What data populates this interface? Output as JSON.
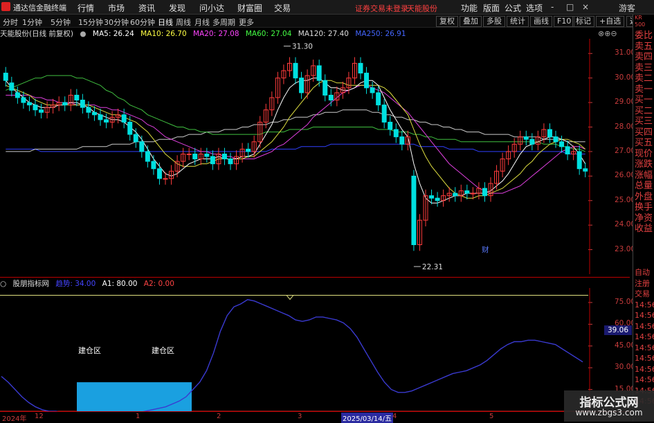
{
  "app": {
    "title": "通达信金融终端",
    "menu": [
      "行情",
      "市场",
      "资讯",
      "发现",
      "问小达",
      "财富圈",
      "交易"
    ],
    "notice_left": "证券交易未登录",
    "notice_right": "天能股份",
    "right_menu": [
      "功能",
      "版面",
      "公式",
      "选项"
    ],
    "window_controls": [
      "-",
      "□",
      "×"
    ],
    "guest": "游客"
  },
  "toolbar": {
    "periods": [
      "分时",
      "1分钟",
      "5分钟",
      "15分钟",
      "30分钟",
      "60分钟",
      "日线",
      "周线",
      "月线",
      "多周期",
      "更多"
    ],
    "active_period": "日线",
    "buttons": [
      "复权",
      "叠加",
      "多股",
      "统计",
      "画线",
      "F10",
      "标记",
      "+自选",
      "返回"
    ]
  },
  "main_chart": {
    "title": "天能股份(日线 前复权)",
    "ma": [
      {
        "label": "MA5: 26.24",
        "color": "#ffffff"
      },
      {
        "label": "MA10: 26.70",
        "color": "#ffff40"
      },
      {
        "label": "MA20: 27.08",
        "color": "#ff40ff"
      },
      {
        "label": "MA60: 27.04",
        "color": "#40ff40"
      },
      {
        "label": "MA120: 27.40",
        "color": "#dddddd"
      },
      {
        "label": "MA250: 26.91",
        "color": "#4060ff"
      }
    ],
    "y_ticks": [
      "31.00",
      "30.00",
      "29.00",
      "28.00",
      "27.00",
      "26.00",
      "25.00",
      "24.00",
      "23.00"
    ],
    "high_label": "31.30",
    "low_label": "22.31",
    "cai_label": "财"
  },
  "indicator": {
    "name": "股朋指标网",
    "values": [
      {
        "label": "趋势: 34.00",
        "color": "#4040ff"
      },
      {
        "label": "A1: 80.00",
        "color": "#ffffff"
      },
      {
        "label": "A2: 0.00",
        "color": "#ff4040"
      }
    ],
    "y_ticks": [
      "75.00",
      "60.00",
      "45.00",
      "30.00",
      "15.00"
    ],
    "current_value": "39.06",
    "zone_label": "建仓区"
  },
  "x_axis": [
    "2024年",
    "12",
    "1",
    "2",
    "3",
    "2025/03/14/五",
    "4",
    "5"
  ],
  "right_column_top": [
    "委比",
    "卖五",
    "卖四",
    "卖三",
    "卖二",
    "卖一",
    "买一",
    "买二",
    "买三",
    "买四",
    "买五",
    "现价",
    "涨跌",
    "涨幅",
    "总量",
    "外盘",
    "换手",
    "净资",
    "收益"
  ],
  "right_column_bottom": [
    "自动",
    "注册",
    "交易",
    "14:56",
    "14:56",
    "14:56",
    "14:56",
    "14:56",
    "14:56",
    "14:56",
    "14:56",
    "14:56",
    "14:56"
  ],
  "corner_label": "KR 500",
  "watermark": {
    "line1": "指标公式网",
    "line2": "www.zbgs3.com"
  },
  "chart_data": {
    "type": "candlestick",
    "price_range": [
      22.0,
      31.6
    ],
    "closes": [
      29.9,
      29.5,
      29.2,
      29.0,
      28.9,
      28.7,
      28.6,
      28.8,
      28.9,
      29.0,
      28.9,
      29.3,
      29.1,
      28.8,
      28.6,
      28.5,
      28.3,
      28.2,
      28.4,
      28.5,
      28.2,
      27.7,
      27.4,
      27.0,
      26.6,
      26.3,
      25.9,
      25.9,
      26.2,
      26.6,
      26.9,
      26.9,
      26.7,
      26.9,
      26.8,
      26.5,
      26.9,
      26.7,
      26.5,
      26.8,
      27.1,
      27.0,
      27.4,
      28.2,
      28.7,
      29.2,
      30.0,
      30.3,
      30.6,
      30.0,
      29.4,
      30.1,
      30.5,
      29.9,
      29.3,
      29.1,
      29.4,
      29.6,
      30.0,
      30.6,
      30.2,
      29.6,
      29.4,
      28.9,
      28.2,
      27.9,
      27.6,
      27.3,
      27.6,
      23.2,
      24.2,
      25.2,
      25.1,
      25.0,
      25.2,
      25.3,
      25.2,
      25.4,
      25.3,
      25.3,
      25.5,
      25.2,
      25.7,
      26.2,
      26.7,
      27.0,
      27.3,
      27.6,
      27.5,
      27.3,
      27.6,
      27.9,
      27.6,
      27.4,
      27.2,
      26.9,
      27.0,
      26.3,
      26.2
    ],
    "opens": [
      30.2,
      29.8,
      29.4,
      29.2,
      29.0,
      28.9,
      28.7,
      28.6,
      28.8,
      28.9,
      29.0,
      28.9,
      29.3,
      29.1,
      28.8,
      28.6,
      28.5,
      28.3,
      28.2,
      28.4,
      28.5,
      28.2,
      27.7,
      27.4,
      27.0,
      26.6,
      26.3,
      25.9,
      25.9,
      26.2,
      26.6,
      26.9,
      26.9,
      26.7,
      26.9,
      26.8,
      26.5,
      26.9,
      26.7,
      26.5,
      26.8,
      27.1,
      27.0,
      27.4,
      28.2,
      28.7,
      29.2,
      30.0,
      30.3,
      30.6,
      30.0,
      29.4,
      30.1,
      30.5,
      29.9,
      29.3,
      29.1,
      29.4,
      29.6,
      30.0,
      30.6,
      30.2,
      29.6,
      29.4,
      28.9,
      28.2,
      27.9,
      27.6,
      27.3,
      26.0,
      23.2,
      24.2,
      25.2,
      25.1,
      25.0,
      25.2,
      25.3,
      25.2,
      25.4,
      25.3,
      25.3,
      25.5,
      25.2,
      25.7,
      26.2,
      26.7,
      27.0,
      27.3,
      27.6,
      27.5,
      27.3,
      27.6,
      27.9,
      27.6,
      27.4,
      27.2,
      26.9,
      27.0,
      26.3
    ],
    "ma5": [
      29.9,
      29.6,
      29.4,
      29.2,
      29.0,
      28.9,
      28.8,
      28.8,
      28.8,
      28.9,
      28.9,
      29.0,
      29.0,
      28.9,
      28.8,
      28.6,
      28.5,
      28.4,
      28.3,
      28.3,
      28.2,
      28.0,
      27.8,
      27.5,
      27.1,
      26.7,
      26.4,
      26.1,
      26.0,
      26.1,
      26.3,
      26.5,
      26.6,
      26.7,
      26.7,
      26.7,
      26.8,
      26.7,
      26.7,
      26.7,
      26.8,
      26.8,
      26.9,
      27.3,
      27.7,
      28.1,
      28.7,
      29.2,
      29.6,
      29.8,
      29.9,
      29.9,
      30.0,
      30.0,
      29.8,
      29.6,
      29.6,
      29.5,
      29.5,
      29.6,
      29.8,
      29.9,
      29.9,
      29.7,
      29.2,
      28.7,
      28.3,
      27.9,
      27.6,
      26.5,
      25.7,
      25.1,
      24.9,
      24.9,
      25.0,
      25.1,
      25.2,
      25.2,
      25.3,
      25.3,
      25.3,
      25.3,
      25.4,
      25.6,
      25.8,
      26.1,
      26.5,
      26.9,
      27.2,
      27.3,
      27.4,
      27.5,
      27.6,
      27.6,
      27.5,
      27.4,
      27.2,
      26.9,
      26.5
    ],
    "ma10": [
      29.7,
      29.6,
      29.5,
      29.4,
      29.3,
      29.1,
      29.0,
      28.9,
      28.9,
      28.9,
      28.9,
      28.9,
      28.9,
      28.9,
      28.9,
      28.8,
      28.7,
      28.6,
      28.5,
      28.5,
      28.4,
      28.3,
      28.2,
      28.0,
      27.8,
      27.5,
      27.2,
      26.9,
      26.7,
      26.5,
      26.4,
      26.4,
      26.4,
      26.5,
      26.5,
      26.6,
      26.7,
      26.7,
      26.7,
      26.7,
      26.7,
      26.8,
      26.8,
      27.0,
      27.2,
      27.4,
      27.7,
      28.0,
      28.4,
      28.7,
      29.0,
      29.3,
      29.6,
      29.8,
      29.9,
      29.9,
      29.8,
      29.8,
      29.7,
      29.7,
      29.7,
      29.7,
      29.7,
      29.7,
      29.6,
      29.4,
      29.1,
      28.8,
      28.5,
      27.9,
      27.3,
      26.8,
      26.4,
      26.1,
      25.8,
      25.5,
      25.3,
      25.2,
      25.1,
      25.1,
      25.2,
      25.2,
      25.3,
      25.4,
      25.5,
      25.7,
      25.9,
      26.1,
      26.4,
      26.6,
      26.9,
      27.1,
      27.3,
      27.4,
      27.5,
      27.5,
      27.4,
      27.3,
      27.1
    ],
    "ma20": [
      29.3,
      29.3,
      29.3,
      29.3,
      29.3,
      29.2,
      29.2,
      29.1,
      29.1,
      29.0,
      29.0,
      29.0,
      28.9,
      28.9,
      28.9,
      28.9,
      28.8,
      28.8,
      28.7,
      28.7,
      28.6,
      28.5,
      28.4,
      28.3,
      28.1,
      28.0,
      27.8,
      27.6,
      27.5,
      27.4,
      27.3,
      27.2,
      27.1,
      27.0,
      27.0,
      26.9,
      26.9,
      26.8,
      26.8,
      26.7,
      26.7,
      26.7,
      26.7,
      26.8,
      26.9,
      27.0,
      27.2,
      27.3,
      27.5,
      27.7,
      27.9,
      28.1,
      28.4,
      28.6,
      28.8,
      29.0,
      29.2,
      29.4,
      29.5,
      29.6,
      29.7,
      29.7,
      29.6,
      29.5,
      29.4,
      29.2,
      29.0,
      28.8,
      28.6,
      28.3,
      28.0,
      27.7,
      27.4,
      27.1,
      26.8,
      26.5,
      26.3,
      26.1,
      25.9,
      25.7,
      25.5,
      25.4,
      25.3,
      25.3,
      25.3,
      25.4,
      25.5,
      25.6,
      25.8,
      26.0,
      26.2,
      26.4,
      26.6,
      26.8,
      27.0,
      27.1,
      27.2,
      27.2,
      27.1
    ],
    "ma60": [
      29.5,
      29.6,
      29.7,
      29.8,
      29.9,
      30.0,
      30.0,
      30.1,
      30.1,
      30.1,
      30.1,
      30.1,
      30.0,
      30.0,
      29.9,
      29.8,
      29.7,
      29.5,
      29.4,
      29.2,
      29.1,
      28.9,
      28.8,
      28.7,
      28.5,
      28.4,
      28.3,
      28.2,
      28.1,
      28.0,
      28.0,
      27.9,
      27.9,
      27.8,
      27.8,
      27.7,
      27.7,
      27.7,
      27.7,
      27.7,
      27.7,
      27.7,
      27.7,
      27.7,
      27.8,
      27.8,
      27.8,
      27.8,
      27.9,
      27.9,
      27.9,
      27.9,
      28.0,
      28.0,
      28.0,
      28.0,
      28.0,
      28.0,
      28.0,
      28.0,
      28.0,
      28.0,
      28.0,
      27.9,
      27.9,
      27.9,
      27.8,
      27.8,
      27.8,
      27.7,
      27.7,
      27.6,
      27.6,
      27.5,
      27.5,
      27.5,
      27.5,
      27.4,
      27.4,
      27.4,
      27.4,
      27.4,
      27.4,
      27.4,
      27.4,
      27.4,
      27.4,
      27.4,
      27.4,
      27.4,
      27.4,
      27.3,
      27.3,
      27.3,
      27.2,
      27.2,
      27.1,
      27.1,
      27.0
    ],
    "ma120": [
      27.0,
      27.0,
      27.0,
      27.0,
      27.0,
      27.1,
      27.1,
      27.1,
      27.1,
      27.1,
      27.1,
      27.1,
      27.1,
      27.2,
      27.2,
      27.2,
      27.2,
      27.2,
      27.3,
      27.3,
      27.3,
      27.3,
      27.4,
      27.4,
      27.4,
      27.4,
      27.5,
      27.5,
      27.5,
      27.6,
      27.6,
      27.7,
      27.7,
      27.7,
      27.8,
      27.8,
      27.8,
      27.9,
      27.9,
      27.9,
      28.0,
      28.0,
      28.1,
      28.1,
      28.1,
      28.2,
      28.2,
      28.3,
      28.3,
      28.4,
      28.4,
      28.4,
      28.5,
      28.5,
      28.6,
      28.6,
      28.6,
      28.7,
      28.7,
      28.7,
      28.7,
      28.7,
      28.6,
      28.6,
      28.5,
      28.5,
      28.4,
      28.4,
      28.3,
      28.3,
      28.2,
      28.2,
      28.1,
      28.1,
      28.0,
      28.0,
      27.9,
      27.9,
      27.8,
      27.8,
      27.8,
      27.7,
      27.7,
      27.7,
      27.7,
      27.7,
      27.6,
      27.6,
      27.6,
      27.6,
      27.6,
      27.5,
      27.5,
      27.5,
      27.5,
      27.4,
      27.4,
      27.4,
      27.4
    ],
    "ma250": [
      27.1,
      27.1,
      27.1,
      27.1,
      27.1,
      27.1,
      27.0,
      27.0,
      27.0,
      27.0,
      27.0,
      27.0,
      27.0,
      27.0,
      27.0,
      27.0,
      27.0,
      27.0,
      27.0,
      27.0,
      27.0,
      27.0,
      27.0,
      27.0,
      27.0,
      27.0,
      27.0,
      27.0,
      27.0,
      27.0,
      27.0,
      27.0,
      27.0,
      27.0,
      27.0,
      27.0,
      27.0,
      27.0,
      27.0,
      27.0,
      27.0,
      27.0,
      27.0,
      27.0,
      27.0,
      27.1,
      27.1,
      27.1,
      27.1,
      27.1,
      27.2,
      27.2,
      27.2,
      27.2,
      27.2,
      27.3,
      27.3,
      27.3,
      27.3,
      27.3,
      27.3,
      27.3,
      27.3,
      27.3,
      27.3,
      27.3,
      27.3,
      27.3,
      27.3,
      27.3,
      27.2,
      27.2,
      27.2,
      27.2,
      27.2,
      27.1,
      27.1,
      27.1,
      27.1,
      27.1,
      27.0,
      27.0,
      27.0,
      27.0,
      27.0,
      27.0,
      27.0,
      27.0,
      27.0,
      27.0,
      27.0,
      27.0,
      27.0,
      27.0,
      27.0,
      26.9,
      26.9,
      26.9,
      26.9
    ],
    "indicator_range": [
      0,
      85
    ],
    "trend": [
      24,
      20,
      15,
      10,
      6,
      3,
      1,
      0,
      0,
      -1,
      -2,
      -3,
      -3,
      -4,
      -3,
      -2,
      -2,
      -1,
      -2,
      -2,
      -1,
      0,
      1,
      2,
      3,
      5,
      7,
      10,
      15,
      20,
      28,
      40,
      55,
      66,
      72,
      74,
      77,
      76,
      74,
      72,
      70,
      68,
      66,
      63,
      62,
      63,
      65,
      65,
      64,
      63,
      61,
      57,
      51,
      43,
      35,
      27,
      20,
      15,
      13,
      13,
      14,
      16,
      18,
      20,
      22,
      24,
      26,
      27,
      28,
      30,
      32,
      35,
      39,
      43,
      46,
      48,
      48,
      49,
      49,
      48,
      47,
      46,
      43,
      40,
      37,
      34
    ],
    "a1": 80,
    "a2": 0
  }
}
